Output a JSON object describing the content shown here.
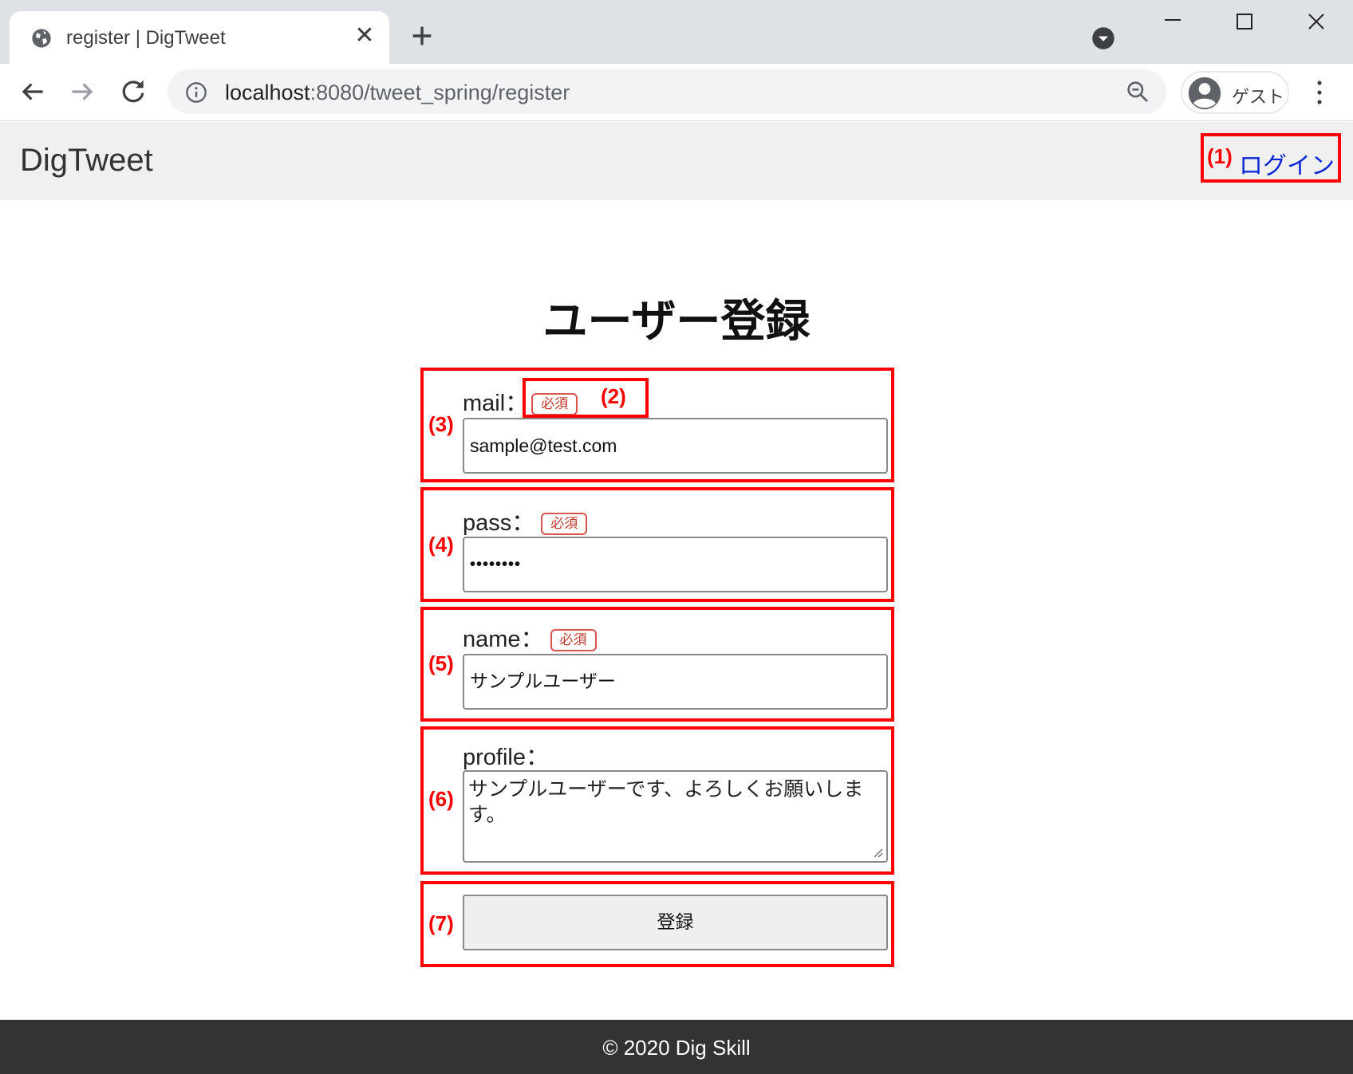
{
  "browser": {
    "tab_title": "register | DigTweet",
    "url_host": "localhost",
    "url_path": ":8080/tweet_spring/register",
    "profile_label": "ゲスト"
  },
  "site": {
    "brand": "DigTweet",
    "login_link": "ログイン"
  },
  "form": {
    "title": "ユーザー登録",
    "required_badge": "必須",
    "mail": {
      "label": "mail：",
      "value": "sample@test.com"
    },
    "pass": {
      "label": "pass：",
      "value": "••••••••"
    },
    "name": {
      "label": "name：",
      "value": "サンプルユーザー"
    },
    "profile": {
      "label": "profile：",
      "value": "サンプルユーザーです、よろしくお願いします。"
    },
    "submit_label": "登録"
  },
  "annotations": {
    "a1": "(1)",
    "a2": "(2)",
    "a3": "(3)",
    "a4": "(4)",
    "a5": "(5)",
    "a6": "(6)",
    "a7": "(7)"
  },
  "footer": {
    "text": "© 2020 Dig Skill"
  },
  "colors": {
    "annotation": "#ff0000",
    "link": "#0a29d6",
    "navbar_bg": "#f0f0f0",
    "footer_bg": "#333333"
  }
}
